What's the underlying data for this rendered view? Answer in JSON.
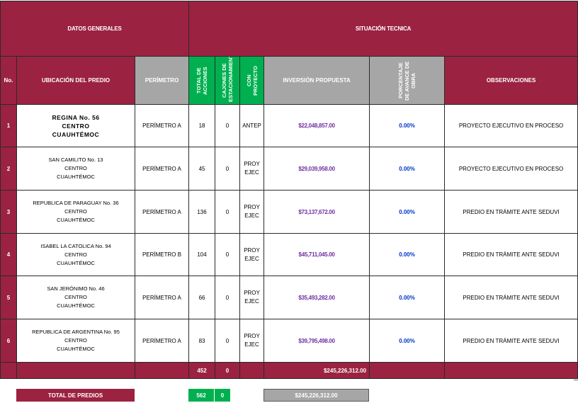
{
  "headers": {
    "datos_generales": "DATOS GENERALES",
    "situacion_tecnica": "SITUACIÓN TECNICA",
    "no": "No.",
    "ubicacion": "UBICACIÓN DEL PREDIO",
    "perimetro": "PERÍMETRO",
    "total_acciones": "TOTAL DE ACCIONES",
    "cajones": "CAJONES DE ESTACIONAMIENTO",
    "con_proyecto": "CON PROYECTO",
    "inversion": "INVERSIÓN PROPUESTA",
    "porcentaje": "PORCENTAJE DE AVANCE DE OBRA",
    "observaciones": "OBSERVACIONES"
  },
  "rows": [
    {
      "no": "1",
      "loc1": "REGINA No. 56",
      "loc2": "CENTRO",
      "loc3": "CUAUHTÉMOC",
      "bold": true,
      "perimetro": "PERÍMETRO A",
      "acciones": "18",
      "cajones": "0",
      "proy1": "ANTEP",
      "proy2": "",
      "inversion": "$22,048,857.00",
      "avance": "0.00%",
      "obs": "PROYECTO EJECUTIVO EN PROCESO"
    },
    {
      "no": "2",
      "loc1": "SAN CAMILITO No. 13",
      "loc2": "CENTRO",
      "loc3": "CUAUHTÉMOC",
      "bold": false,
      "perimetro": "PERÍMETRO A",
      "acciones": "45",
      "cajones": "0",
      "proy1": "PROY",
      "proy2": "EJEC",
      "inversion": "$29,039,958.00",
      "avance": "0.00%",
      "obs": "PROYECTO EJECUTIVO EN PROCESO"
    },
    {
      "no": "3",
      "loc1": "REPUBLICA DE PARAGUAY No. 36",
      "loc2": "CENTRO",
      "loc3": "CUAUHTÉMOC",
      "bold": false,
      "perimetro": "PERÍMETRO A",
      "acciones": "136",
      "cajones": "0",
      "proy1": "PROY",
      "proy2": "EJEC",
      "inversion": "$73,137,672.00",
      "avance": "0.00%",
      "obs": "PREDIO EN TRÁMITE ANTE SEDUVI"
    },
    {
      "no": "4",
      "loc1": "ISABEL LA CATOLICA No. 94",
      "loc2": "CENTRO",
      "loc3": "CUAUHTÉMOC",
      "bold": false,
      "perimetro": "PERÍMETRO B",
      "acciones": "104",
      "cajones": "0",
      "proy1": "PROY",
      "proy2": "EJEC",
      "inversion": "$45,711,045.00",
      "avance": "0.00%",
      "obs": "PREDIO EN TRÁMITE ANTE SEDUVI"
    },
    {
      "no": "5",
      "loc1": "SAN JERÓNIMO No. 46",
      "loc2": "CENTRO",
      "loc3": "CUAUHTÉMOC",
      "bold": false,
      "perimetro": "PERÍMETRO A",
      "acciones": "66",
      "cajones": "0",
      "proy1": "PROY",
      "proy2": "EJEC",
      "inversion": "$35,493,282.00",
      "avance": "0.00%",
      "obs": "PREDIO EN TRÁMITE ANTE SEDUVI"
    },
    {
      "no": "6",
      "loc1": "REPUBLICA DE ARGENTINA No. 95",
      "loc2": "CENTRO",
      "loc3": "CUAUHTÉMOC",
      "bold": false,
      "perimetro": "PERÍMETRO A",
      "acciones": "83",
      "cajones": "0",
      "proy1": "PROY",
      "proy2": "EJEC",
      "inversion": "$39,795,498.00",
      "avance": "0.00%",
      "obs": "PREDIO EN TRÁMITE ANTE SEDUVI"
    }
  ],
  "totals_row": {
    "acciones": "452",
    "cajones": "0",
    "inversion": "$245,226,312.00"
  },
  "summary": {
    "label": "TOTAL DE PREDIOS",
    "acciones": "562",
    "cajones": "0",
    "inversion": "$245,226,312.00"
  },
  "colors": {
    "maroon": "#9b2241",
    "gray": "#a6a6a6",
    "green": "#00b050",
    "money": "#7030a0",
    "percent": "#0033cc"
  }
}
